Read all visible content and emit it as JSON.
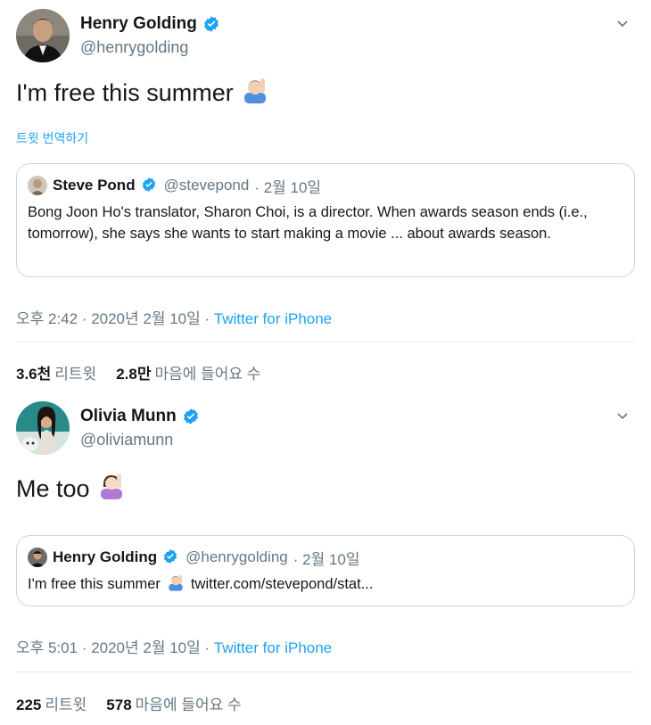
{
  "colors": {
    "link": "#1da1f2",
    "verified": "#1da1f2",
    "secondary_text": "#657786",
    "border": "#ccd6dd"
  },
  "tweets": [
    {
      "display_name": "Henry Golding",
      "handle": "@henrygolding",
      "text": "I'm free this summer",
      "text_emoji": "person-raising-hand-emoji",
      "translate_label": "트윗 번역하기",
      "quote": {
        "name": "Steve Pond",
        "handle": "@stevepond",
        "date": "· 2월 10일",
        "body": "Bong Joon Ho's translator, Sharon Choi, is a director. When awards season ends (i.e., tomorrow), she says she wants to start making a movie ... about awards season."
      },
      "time": "오후 2:42 · 2020년 2월 10일 · ",
      "source": "Twitter for iPhone",
      "retweets_count": "3.6천",
      "retweets_label": "리트윗",
      "likes_count": "2.8만",
      "likes_label": "마음에 들어요 수"
    },
    {
      "display_name": "Olivia Munn",
      "handle": "@oliviamunn",
      "text": "Me too",
      "text_emoji": "woman-raising-hand-emoji",
      "quote": {
        "name": "Henry Golding",
        "handle": "@henrygolding",
        "date": "· 2월 10일",
        "body": "I'm free this summer",
        "link": "twitter.com/stevepond/stat..."
      },
      "time": "오후 5:01 · 2020년 2월 10일 · ",
      "source": "Twitter for iPhone",
      "retweets_count": "225",
      "retweets_label": "리트윗",
      "likes_count": "578",
      "likes_label": "마음에 들어요 수"
    }
  ]
}
